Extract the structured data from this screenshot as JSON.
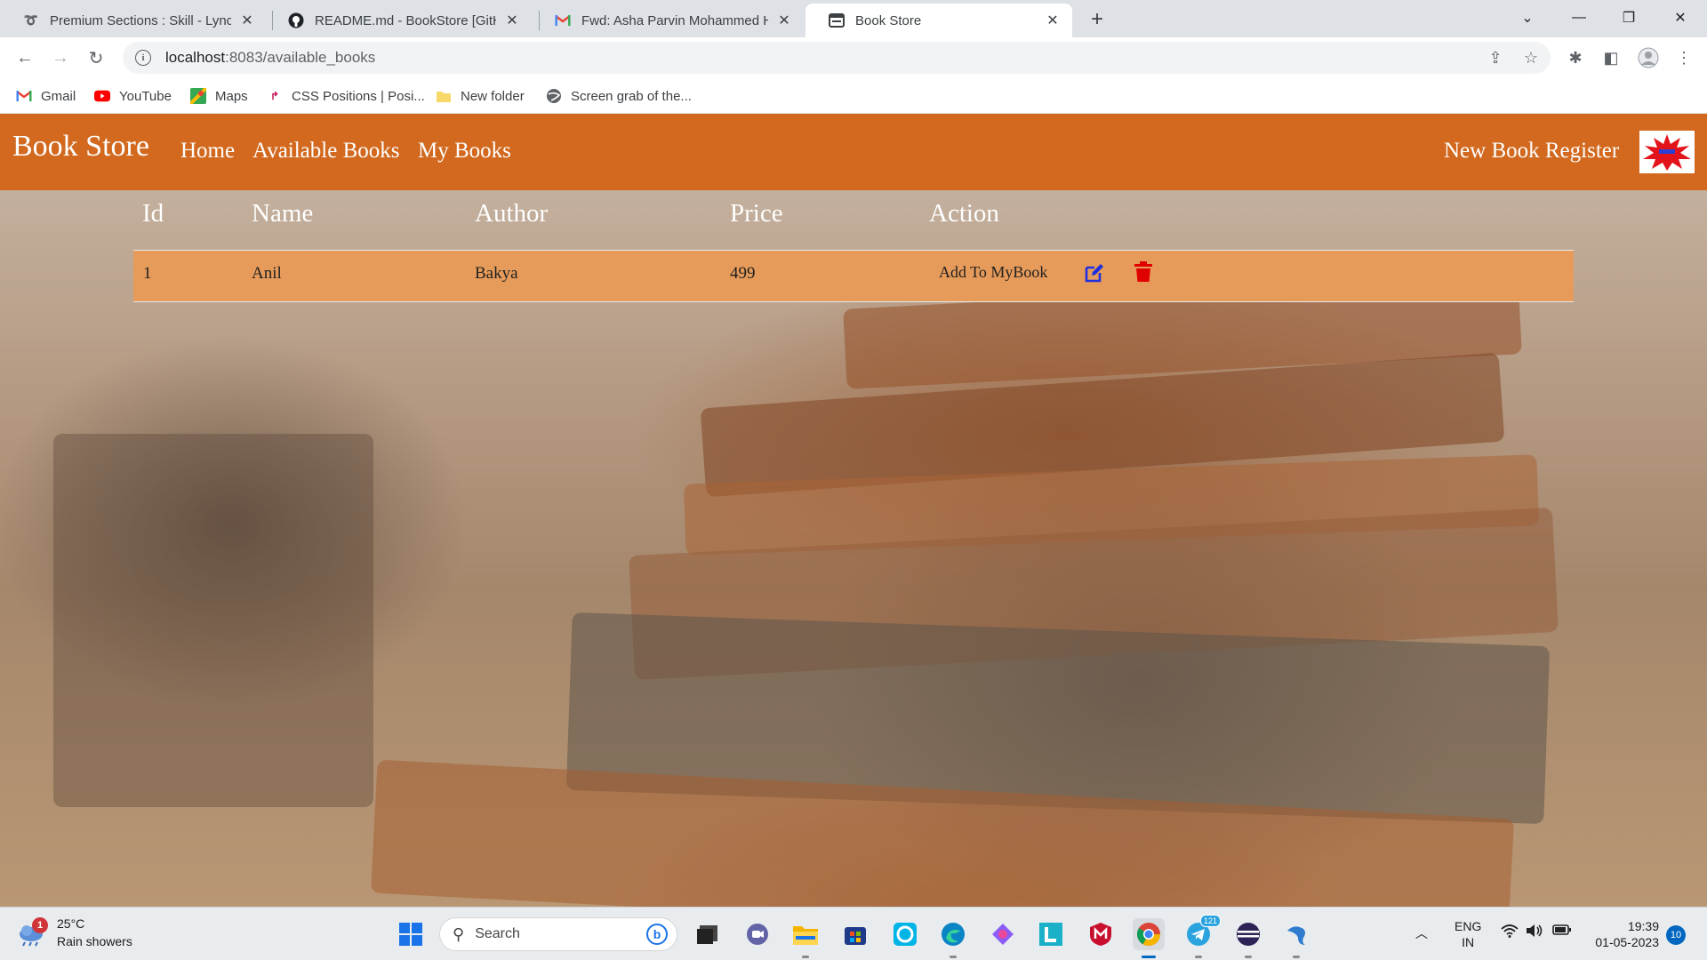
{
  "browser": {
    "tabs": [
      {
        "title": "Premium Sections : Skill - Lync",
        "icon": "lync-icon"
      },
      {
        "title": "README.md - BookStore [GitHub",
        "icon": "github-icon"
      },
      {
        "title": "Fwd: Asha Parvin Mohammed Ha",
        "icon": "gmail-icon"
      },
      {
        "title": "Book Store",
        "icon": "page-icon",
        "active": true
      }
    ],
    "url_host": "localhost",
    "url_path": ":8083/available_books",
    "bookmarks": [
      {
        "label": "Gmail",
        "icon": "gmail-icon"
      },
      {
        "label": "YouTube",
        "icon": "youtube-icon"
      },
      {
        "label": "Maps",
        "icon": "maps-icon"
      },
      {
        "label": "CSS Positions | Posi...",
        "icon": "css-icon"
      },
      {
        "label": "New folder",
        "icon": "folder-icon"
      },
      {
        "label": "Screen grab of the...",
        "icon": "globe-icon"
      }
    ]
  },
  "app": {
    "brand": "Book Store",
    "nav": {
      "home": "Home",
      "available_books": "Available Books",
      "my_books": "My Books",
      "new_book_register": "New Book Register"
    },
    "accent_color": "#d2691e",
    "row_color": "#e69b5a"
  },
  "table": {
    "headers": {
      "id": "Id",
      "name": "Name",
      "author": "Author",
      "price": "Price",
      "action": "Action"
    },
    "rows": [
      {
        "id": "1",
        "name": "Anil",
        "author": "Bakya",
        "price": "499",
        "action_label": "Add To MyBook"
      }
    ]
  },
  "taskbar": {
    "weather_badge": "1",
    "temperature": "25°C",
    "condition": "Rain showers",
    "search_placeholder": "Search",
    "telegram_badge": "121",
    "language_top": "ENG",
    "language_bottom": "IN",
    "time": "19:39",
    "date": "01-05-2023",
    "notifications": "10"
  }
}
